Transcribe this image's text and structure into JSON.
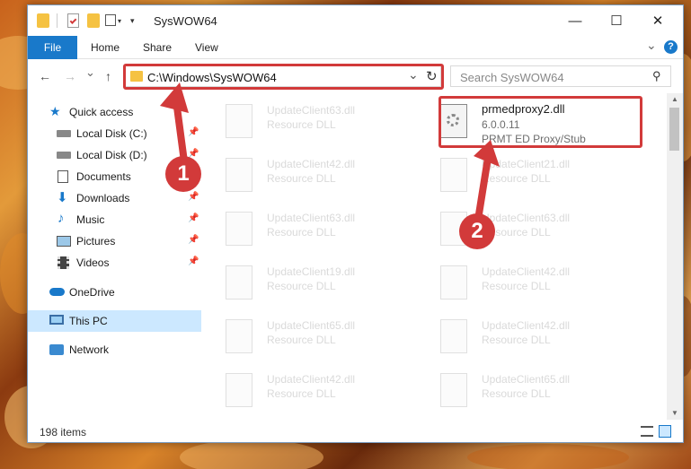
{
  "window": {
    "title": "SysWOW64",
    "minimize_symbol": "—",
    "maximize_symbol": "☐",
    "close_symbol": "✕"
  },
  "ribbon": {
    "tabs": [
      "File",
      "Home",
      "Share",
      "View"
    ],
    "expand_symbol": "⌄",
    "help_symbol": "?"
  },
  "nav": {
    "back_symbol": "←",
    "forward_symbol": "→",
    "recent_symbol": "⌄",
    "up_symbol": "↑",
    "address": "C:\\Windows\\SysWOW64",
    "dropdown_symbol": "⌄",
    "refresh_symbol": "↻",
    "search_placeholder": "Search SysWOW64",
    "search_symbol": "⚲"
  },
  "sidebar": {
    "items": [
      {
        "label": "Quick access",
        "icon": "star-icon"
      },
      {
        "label": "Local Disk (C:)",
        "icon": "drive-icon",
        "pinned": true
      },
      {
        "label": "Local Disk (D:)",
        "icon": "drive-icon",
        "pinned": true
      },
      {
        "label": "Documents",
        "icon": "document-icon",
        "pinned": true
      },
      {
        "label": "Downloads",
        "icon": "download-icon",
        "pinned": true
      },
      {
        "label": "Music",
        "icon": "music-icon",
        "pinned": true
      },
      {
        "label": "Pictures",
        "icon": "picture-icon",
        "pinned": true
      },
      {
        "label": "Videos",
        "icon": "video-icon",
        "pinned": true
      },
      {
        "label": "OneDrive",
        "icon": "cloud-icon"
      },
      {
        "label": "This PC",
        "icon": "computer-icon",
        "selected": true
      },
      {
        "label": "Network",
        "icon": "network-icon"
      }
    ],
    "pin_symbol": "📌"
  },
  "files": {
    "highlighted": {
      "name": "prmedproxy2.dll",
      "version": "6.0.0.11",
      "description": "PRMT ED Proxy/Stub"
    },
    "left_column": [
      {
        "name": "UpdateClient63.dll",
        "type": "Resource DLL"
      },
      {
        "name": "UpdateClient42.dll",
        "type": "Resource DLL"
      },
      {
        "name": "UpdateClient63.dll",
        "type": "Resource DLL"
      },
      {
        "name": "UpdateClient19.dll",
        "type": "Resource DLL"
      },
      {
        "name": "UpdateClient65.dll",
        "type": "Resource DLL"
      },
      {
        "name": "UpdateClient42.dll",
        "type": "Resource DLL"
      }
    ],
    "right_column": [
      {
        "name": "UpdateClient21.dll",
        "type": "Resource DLL"
      },
      {
        "name": "UpdateClient63.dll",
        "type": "Resource DLL"
      },
      {
        "name": "UpdateClient42.dll",
        "type": "Resource DLL"
      },
      {
        "name": "UpdateClient42.dll",
        "type": "Resource DLL"
      },
      {
        "name": "UpdateClient65.dll",
        "type": "Resource DLL"
      }
    ]
  },
  "status": {
    "item_count": "198 items"
  },
  "annotations": {
    "step1": "1",
    "step2": "2"
  },
  "colors": {
    "accent": "#1979ca",
    "highlight": "#d23a3a",
    "selection": "#cce8ff"
  }
}
